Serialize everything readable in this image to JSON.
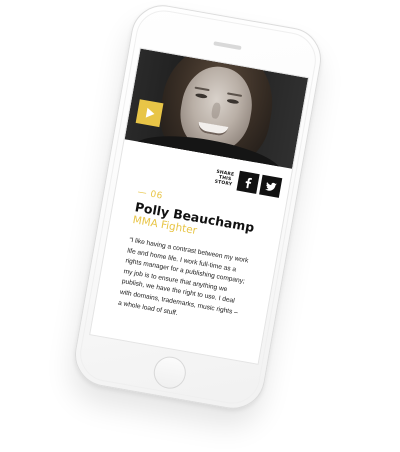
{
  "share": {
    "label": "SHARE\nTHIS\nSTORY"
  },
  "icons": {
    "play": "play-icon",
    "facebook": "facebook-icon",
    "twitter": "twitter-icon"
  },
  "colors": {
    "accent": "#e8c547",
    "text": "#111111",
    "social_bg": "#111111"
  },
  "story": {
    "number": "— 06",
    "name": "Polly Beauchamp",
    "role": "MMA Fighter",
    "quote_lines": [
      "“I like having a contrast between my work",
      "life and home life. I work full-time as a",
      "rights manager for a publishing company;",
      "my job is to ensure that anything we",
      "publish, we have the right to use. I deal",
      "with domains, trademarks, music rights –",
      "a whole load of stuff."
    ]
  }
}
